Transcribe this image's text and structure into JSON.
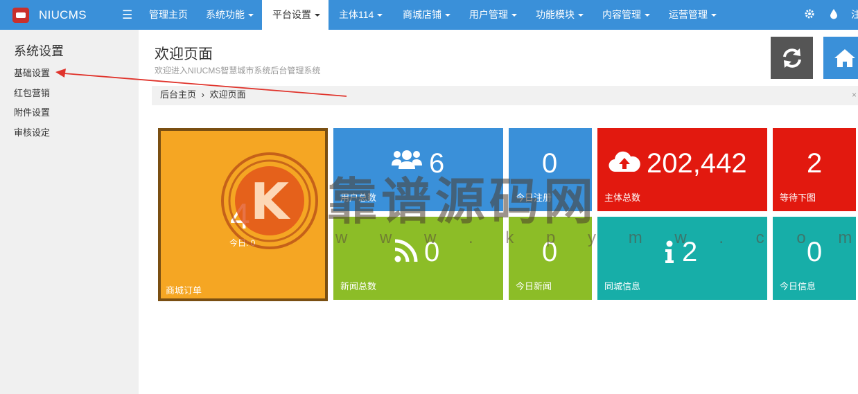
{
  "brand": {
    "name": "NIUCMS",
    "logo_text": "NIUCMS"
  },
  "nav": {
    "menu_icon": "menu-icon",
    "items": [
      {
        "label": "管理主页",
        "dropdown": false,
        "active": false
      },
      {
        "label": "系统功能",
        "dropdown": true,
        "active": false
      },
      {
        "label": "平台设置",
        "dropdown": true,
        "active": true
      },
      {
        "label": "主体114",
        "dropdown": true,
        "active": false
      },
      {
        "label": "商城店铺",
        "dropdown": true,
        "active": false
      },
      {
        "label": "用户管理",
        "dropdown": true,
        "active": false
      },
      {
        "label": "功能模块",
        "dropdown": true,
        "active": false
      },
      {
        "label": "内容管理",
        "dropdown": true,
        "active": false
      },
      {
        "label": "运营管理",
        "dropdown": true,
        "active": false
      }
    ],
    "right_icons": [
      "gear-icon",
      "water-drop-icon"
    ],
    "right_text": "注"
  },
  "sidebar": {
    "title": "系统设置",
    "items": [
      {
        "label": "基础设置"
      },
      {
        "label": "红包营销"
      },
      {
        "label": "附件设置"
      },
      {
        "label": "审核设定"
      }
    ]
  },
  "header": {
    "title": "欢迎页面",
    "subtitle": "欢迎进入NIUCMS智慧城市系统后台管理系统"
  },
  "toolbar": {
    "refresh_icon": "refresh-icon",
    "home_icon": "home-icon"
  },
  "breadcrumb": {
    "home": "后台主页",
    "separator": "›",
    "current": "欢迎页面",
    "close": "×"
  },
  "tiles": {
    "orders": {
      "value": "4",
      "sub": "今日: 0",
      "label": "商城订单",
      "color": "#f5a623"
    },
    "users": {
      "value": "6",
      "label": "用户总数",
      "icon": "users-icon",
      "color": "#3a90d9"
    },
    "today_register": {
      "value": "0",
      "label": "今日注册",
      "color": "#3a90d9"
    },
    "entities": {
      "value": "202,442",
      "label": "主体总数",
      "icon": "cloud-upload-icon",
      "color": "#e2190f"
    },
    "pending_images": {
      "value": "2",
      "label": "等待下图",
      "color": "#e2190f"
    },
    "news": {
      "value": "0",
      "label": "新闻总数",
      "icon": "rss-icon",
      "color": "#8cbd27"
    },
    "today_news": {
      "value": "0",
      "label": "今日新闻",
      "color": "#8cbd27"
    },
    "local_info": {
      "value": "2",
      "label": "同城信息",
      "icon": "info-icon",
      "color": "#17aea8"
    },
    "today_info": {
      "value": "0",
      "label": "今日信息",
      "color": "#17aea8"
    }
  },
  "watermark": {
    "text": "靠谱源码网",
    "url": "w w w . k p y m w . c o m",
    "badge_letter": "K"
  }
}
